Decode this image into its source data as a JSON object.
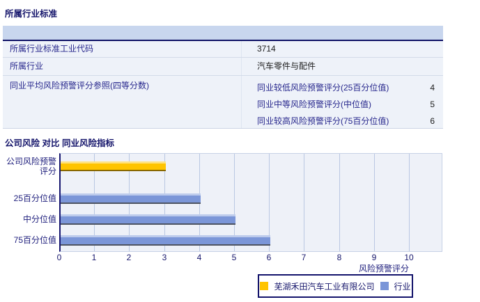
{
  "section1": {
    "title": "所属行业标准",
    "table": {
      "rows": [
        {
          "label": "所属行业标准工业代码",
          "value": "3714"
        },
        {
          "label": "所属行业",
          "value": "汽车零件与配件"
        },
        {
          "label": "同业平均风险预警评分参照(四等分数)",
          "sub_rows": [
            {
              "label": "同业较低风险预警评分(25百分位值)",
              "value": "4"
            },
            {
              "label": "同业中等风险预警评分(中位值)",
              "value": "5"
            },
            {
              "label": "同业较高风险预警评分(75百分位值)",
              "value": "6"
            }
          ]
        }
      ]
    }
  },
  "section2": {
    "title": "公司风险 对比 同业风险指标"
  },
  "chart_data": {
    "type": "bar",
    "orientation": "horizontal",
    "title": "公司风险 对比 同业风险指标",
    "categories": [
      "公司风险预警评分",
      "25百分位值",
      "中分位值",
      "75百分位值"
    ],
    "values": [
      3,
      4,
      5,
      6
    ],
    "series": [
      {
        "name": "芜湖禾田汽车工业有限公司",
        "color": "#ffc400",
        "values": [
          3,
          null,
          null,
          null
        ]
      },
      {
        "name": "行业",
        "color": "#7b96d8",
        "values": [
          null,
          4,
          5,
          6
        ]
      }
    ],
    "xlabel": "风险预警评分",
    "x_ticks": [
      0,
      1,
      2,
      3,
      4,
      5,
      6,
      7,
      8,
      9,
      10
    ],
    "xlim": [
      0,
      10
    ],
    "grid": true,
    "legend_position": "bottom"
  },
  "colors": {
    "header_bg": "#c8d6ee",
    "row_bg": "#eef2f9",
    "navy_border": "#0d1065",
    "label_text": "#26268c",
    "plot_bg": "#eef1f8",
    "gridline": "#b9c7e2",
    "company_bar": "#ffc400",
    "industry_bar": "#7b96d8"
  }
}
